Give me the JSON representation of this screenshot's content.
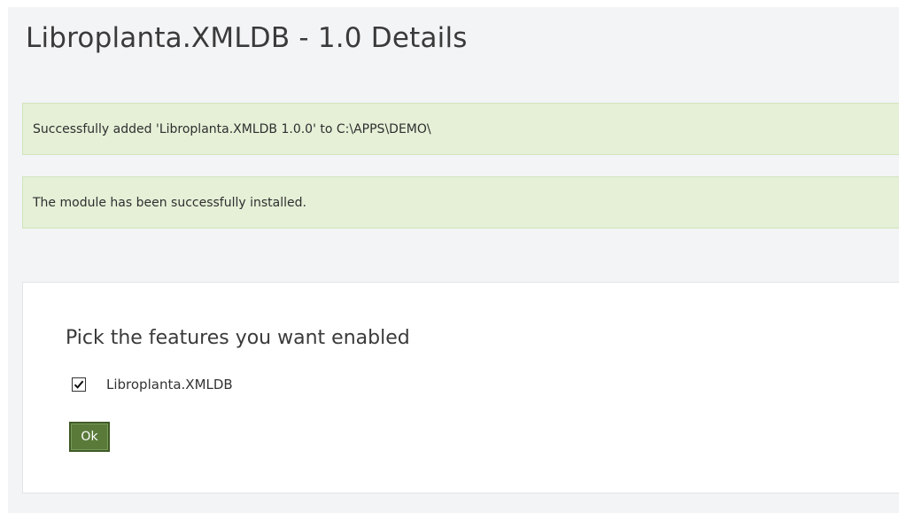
{
  "page": {
    "title": "Libroplanta.XMLDB - 1.0 Details"
  },
  "alerts": [
    {
      "text": "Successfully added 'Libroplanta.XMLDB 1.0.0' to C:\\APPS\\DEMO\\"
    },
    {
      "text": "The module has been successfully installed."
    }
  ],
  "features_panel": {
    "heading": "Pick the features you want enabled",
    "features": [
      {
        "label": "Libroplanta.XMLDB",
        "checked": true
      }
    ],
    "ok_label": "Ok"
  },
  "colors": {
    "alert_background": "#e5f0d7",
    "button_background": "#5a7a3a",
    "page_background": "#f3f4f6"
  },
  "icons": {
    "checkmark": "check-icon"
  }
}
